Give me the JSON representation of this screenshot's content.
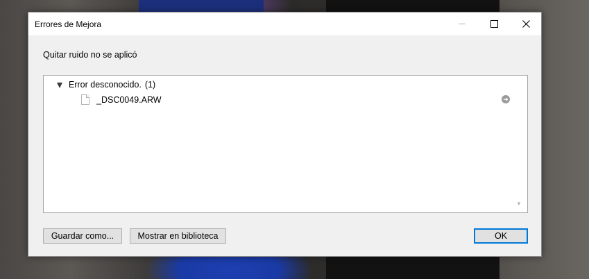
{
  "window": {
    "title": "Errores de Mejora"
  },
  "message": "Quitar ruido no se aplicó",
  "tree": {
    "groups": [
      {
        "label": "Error desconocido.",
        "count": "(1)",
        "expanded": true,
        "files": [
          {
            "name": "_DSC0049.ARW"
          }
        ]
      }
    ]
  },
  "buttons": {
    "save_as": "Guardar como...",
    "show_in_library": "Mostrar en biblioteca",
    "ok": "OK"
  },
  "icons": {
    "collapse": "triangle-down-icon",
    "file": "file-icon",
    "goto": "arrow-circle-icon",
    "minimize": "minimize-icon",
    "maximize": "maximize-icon",
    "close": "close-icon"
  },
  "colors": {
    "dialog_bg": "#f0f0f0",
    "ok_border": "#0078d7"
  }
}
